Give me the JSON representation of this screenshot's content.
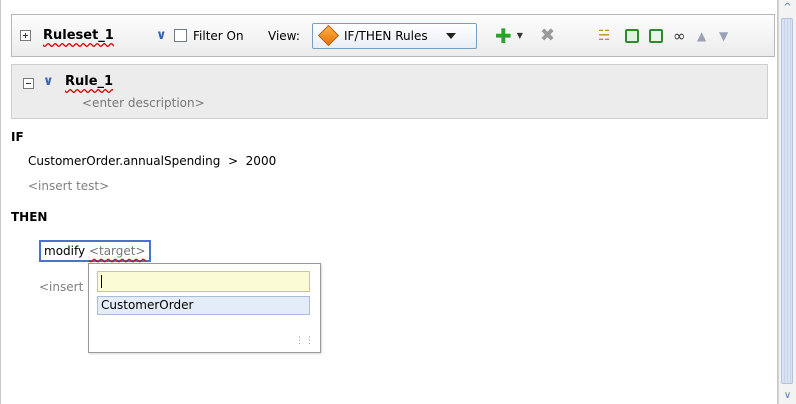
{
  "toolbar": {
    "ruleset_name": "Ruleset_1",
    "filter_label": "Filter On",
    "view_label": "View:",
    "view_selected": "IF/THEN Rules"
  },
  "rule": {
    "name": "Rule_1",
    "description_placeholder": "<enter description>"
  },
  "body": {
    "if_label": "IF",
    "condition": "CustomerOrder.annualSpending  >  2000",
    "insert_test": "<insert test>",
    "then_label": "THEN",
    "action_keyword": "modify",
    "action_target": "<target>",
    "insert_action_partial": "<insert"
  },
  "popup": {
    "input_value": "",
    "options": [
      "CustomerOrder"
    ]
  },
  "colors": {
    "accent": "#4a74c9",
    "add_green": "#2ea02e",
    "delete_gray": "#9a9a9a"
  },
  "icons": {
    "add": "add-icon",
    "delete": "delete-icon",
    "tree": "tree-icon",
    "copy": "copy-icon",
    "paste": "paste-icon",
    "preview": "glasses-icon",
    "up": "move-up-icon",
    "down": "move-down-icon"
  }
}
